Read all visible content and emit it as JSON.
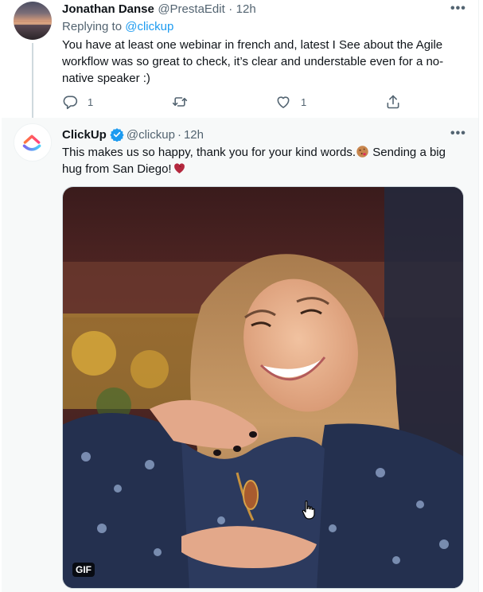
{
  "reply_tweet": {
    "author_name": "Jonathan Danse",
    "author_handle": "@PrestaEdit",
    "separator": "·",
    "time": "12h",
    "replying_prefix": "Replying to",
    "replying_to": "@clickup",
    "text": "You have at least one webinar in french and, latest I See about the Agile workflow was so great to check, it’s clear and understable even for a no-native speaker :)",
    "more_label": "•••",
    "actions": {
      "reply_count": "1",
      "retweet_count": "",
      "like_count": "1"
    }
  },
  "main_tweet": {
    "author_name": "ClickUp",
    "author_handle": "@clickup",
    "separator": "·",
    "time": "12h",
    "text_part1": "This makes us so happy, thank you for your kind words.",
    "text_part2": " Sending a big hug from San Diego!",
    "more_label": "•••",
    "media_badge": "GIF",
    "verified_color": "#1d9bf0"
  },
  "colors": {
    "link": "#1d9bf0",
    "secondary_text": "#536471",
    "primary_text": "#0f1419",
    "hover_background": "#f7f9f9"
  },
  "icons": [
    "reply-icon",
    "retweet-icon",
    "like-icon",
    "share-icon",
    "verified-icon",
    "more-icon",
    "clickup-logo",
    "hand-cursor-icon"
  ]
}
